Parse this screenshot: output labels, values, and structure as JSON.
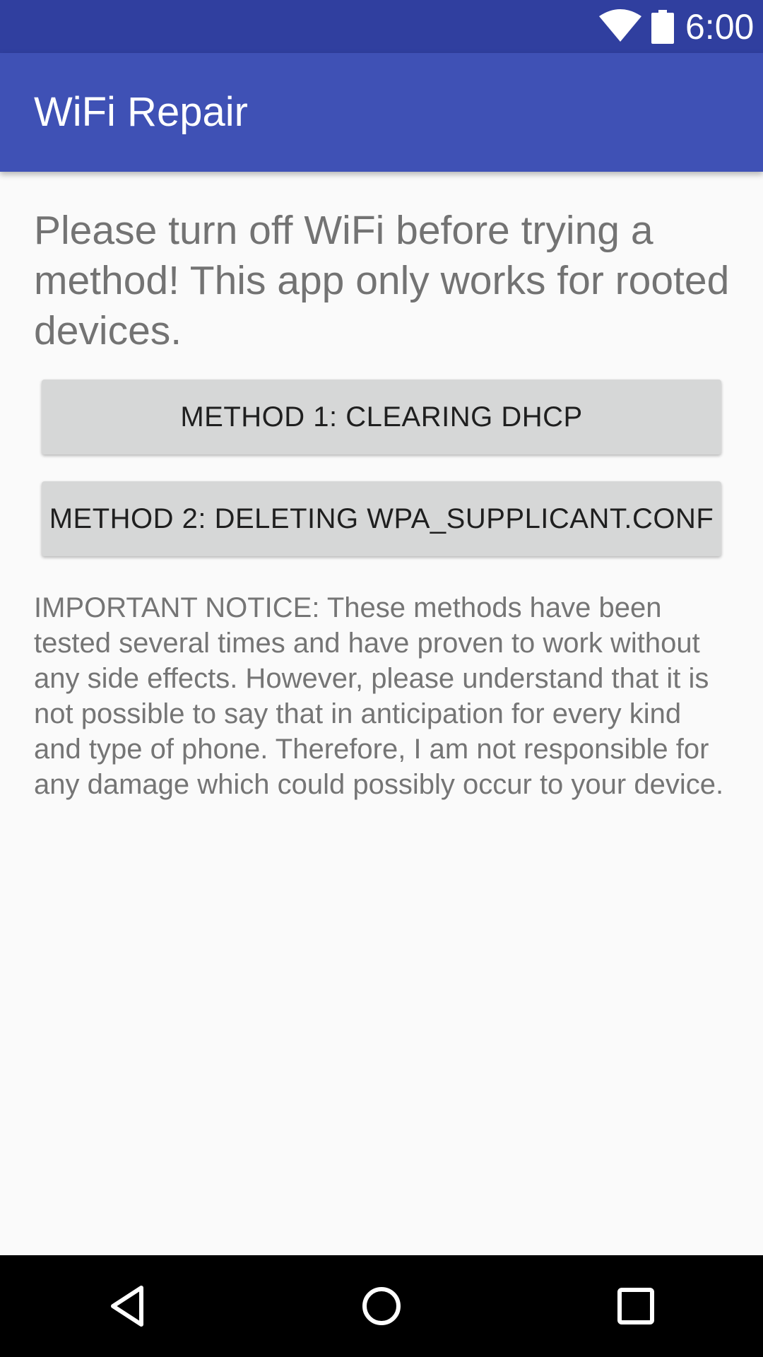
{
  "status_bar": {
    "time": "6:00",
    "icons": [
      "wifi-icon",
      "battery-icon"
    ]
  },
  "app_bar": {
    "title": "WiFi Repair"
  },
  "main": {
    "instruction": "Please turn off WiFi before trying a method! This app only works for rooted devices.",
    "buttons": [
      {
        "label": "METHOD 1: CLEARING DHCP"
      },
      {
        "label": "METHOD 2: DELETING WPA_SUPPLICANT.CONF"
      }
    ],
    "notice": "IMPORTANT NOTICE: These methods have been tested several times and have proven to work without any side effects. However, please understand that it is not possible to say that in anticipation for every kind and type of phone. Therefore, I am not responsible for any damage which could possibly occur to your device."
  },
  "nav_bar": {
    "icons": [
      "back-icon",
      "home-icon",
      "recents-icon"
    ]
  },
  "colors": {
    "status_bar": "#303f9f",
    "app_bar": "#3f51b5",
    "background": "#fafafa",
    "button": "#d6d7d7",
    "text_secondary": "#757575"
  }
}
